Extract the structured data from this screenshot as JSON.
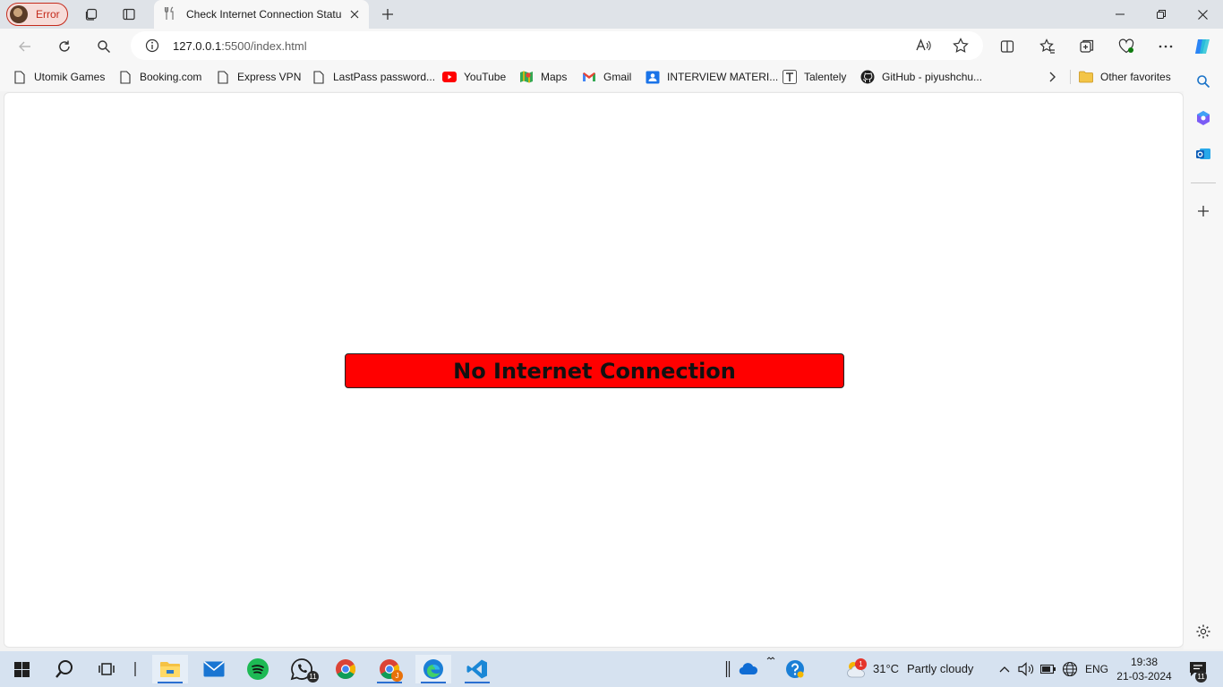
{
  "browser": {
    "profile_label": "Error",
    "tab_title": "Check Internet Connection Status",
    "url_host": "127.0.0.1",
    "url_path": ":5500/index.html"
  },
  "favorites": [
    {
      "label": "Utomik Games",
      "icon": "page-icon"
    },
    {
      "label": "Booking.com",
      "icon": "page-icon"
    },
    {
      "label": "Express VPN",
      "icon": "page-icon"
    },
    {
      "label": "LastPass password...",
      "icon": "page-icon"
    },
    {
      "label": "YouTube",
      "icon": "youtube-icon"
    },
    {
      "label": "Maps",
      "icon": "maps-icon"
    },
    {
      "label": "Gmail",
      "icon": "gmail-icon"
    },
    {
      "label": "INTERVIEW MATERI...",
      "icon": "contact-icon"
    },
    {
      "label": "Talentely",
      "icon": "talentely-icon"
    },
    {
      "label": "GitHub - piyushchu...",
      "icon": "github-icon"
    }
  ],
  "other_favorites": "Other favorites",
  "page": {
    "status_message": "No Internet Connection",
    "status_color": "#ff0000"
  },
  "taskbar": {
    "whatsapp_badge": "11",
    "chrome_badge": "J",
    "weather_badge": "1",
    "temperature": "31°C",
    "weather": "Partly cloudy",
    "language": "ENG",
    "time": "19:38",
    "date": "21-03-2024",
    "notifications": "11"
  }
}
